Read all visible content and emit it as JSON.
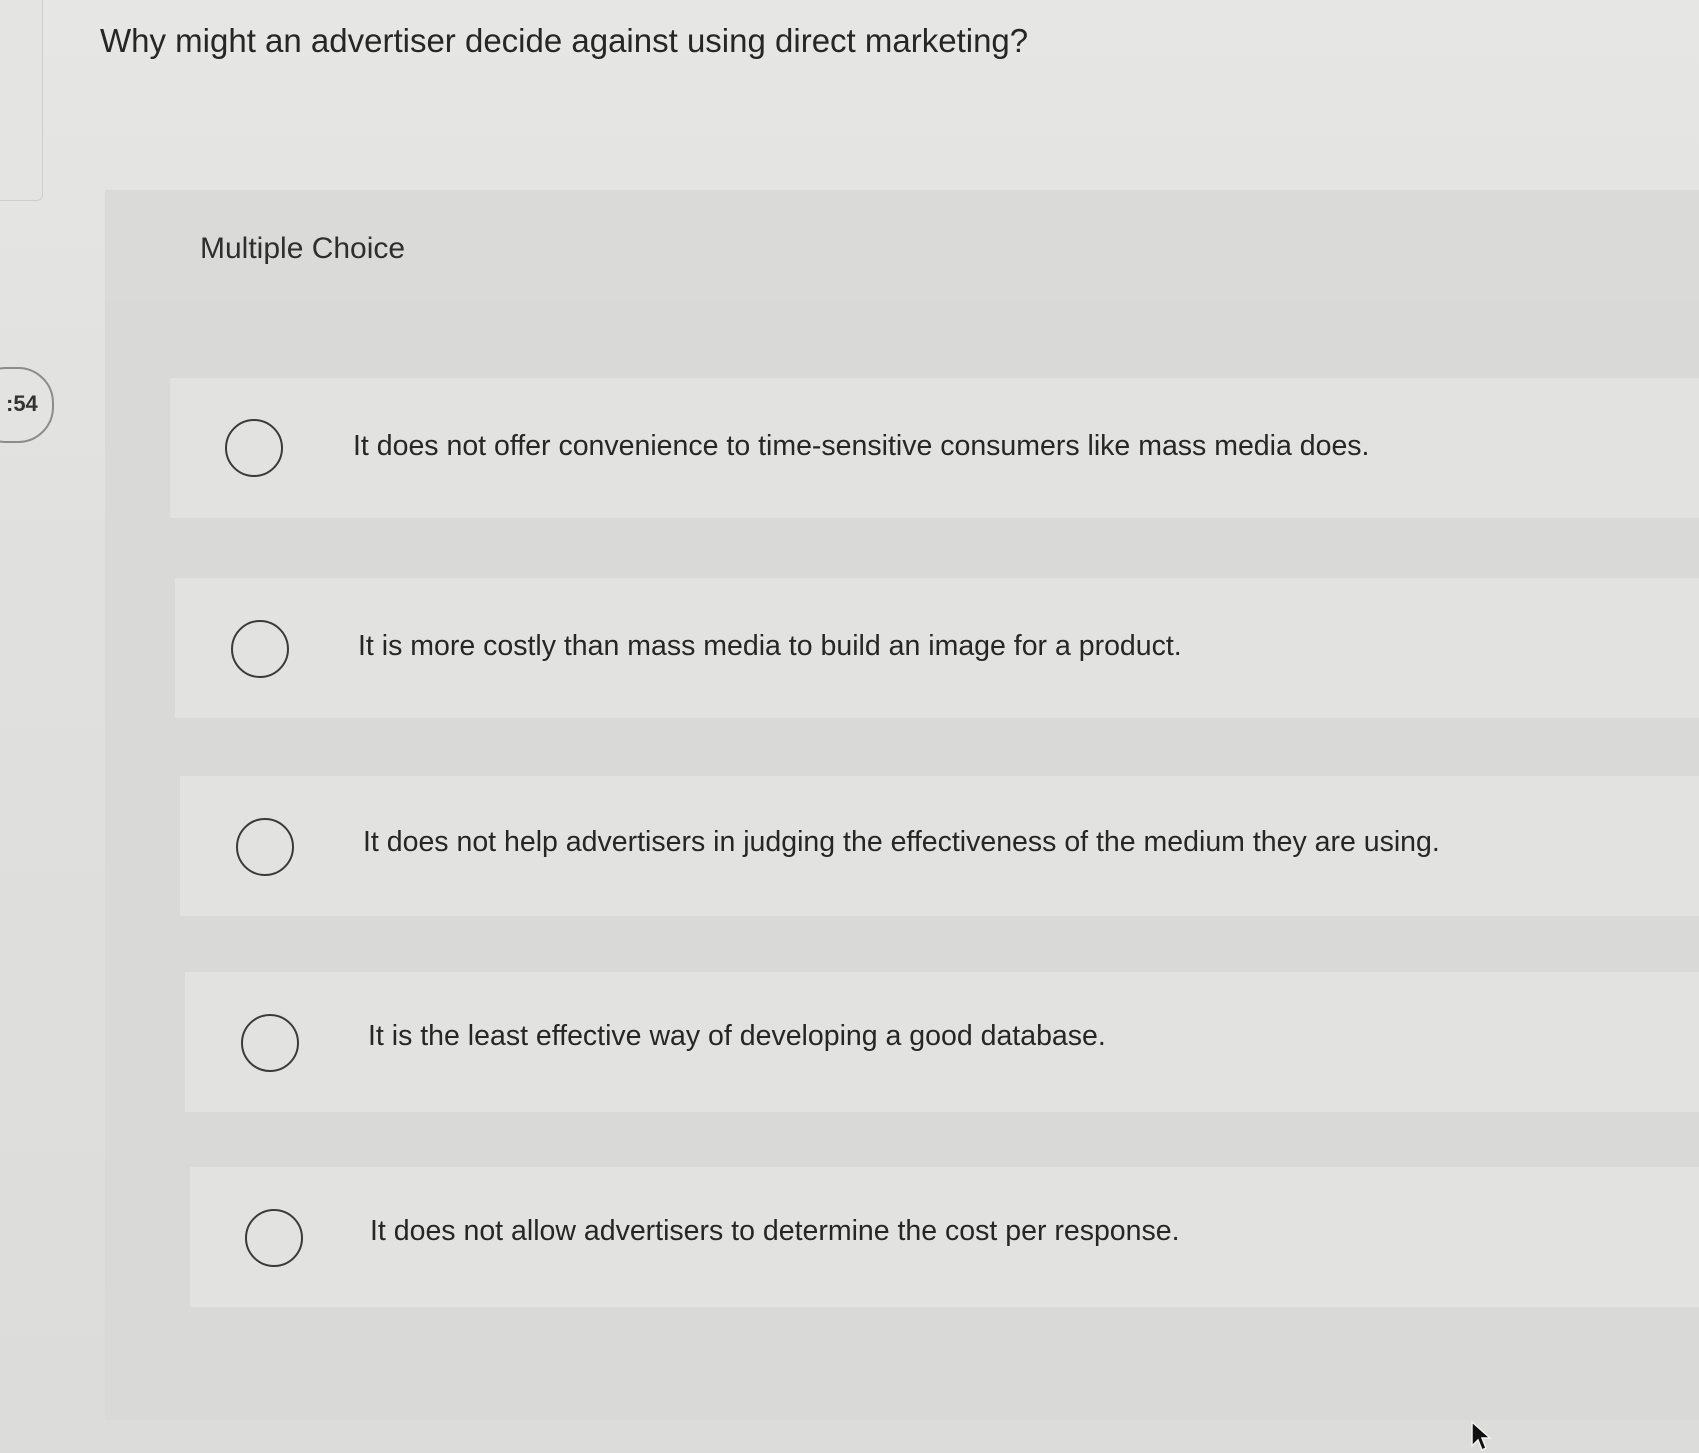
{
  "question": {
    "text": "Why might an advertiser decide against using direct marketing?"
  },
  "timer": {
    "text": ":54"
  },
  "section": {
    "label": "Multiple Choice"
  },
  "options": [
    {
      "text": "It does not offer convenience to time-sensitive consumers like mass media does."
    },
    {
      "text": "It is more costly than mass media to build an image for a product."
    },
    {
      "text": "It does not help advertisers in judging the effectiveness of the medium they are using."
    },
    {
      "text": "It is the least effective way of developing a good database."
    },
    {
      "text": "It does not allow advertisers to determine the cost per response."
    }
  ],
  "icons": {
    "radio": "radio-unselected-icon",
    "cursor": "mouse-pointer-icon"
  }
}
